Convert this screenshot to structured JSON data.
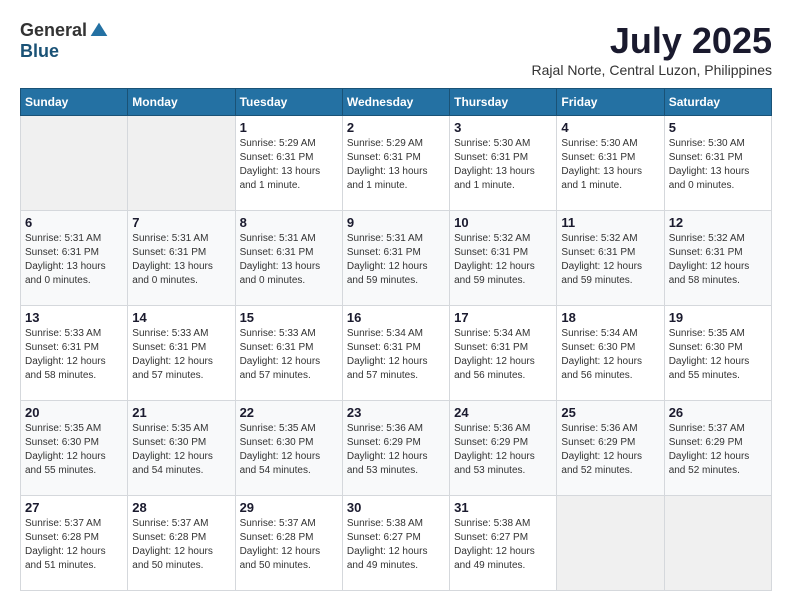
{
  "header": {
    "logo_general": "General",
    "logo_blue": "Blue",
    "month_title": "July 2025",
    "location": "Rajal Norte, Central Luzon, Philippines"
  },
  "days_of_week": [
    "Sunday",
    "Monday",
    "Tuesday",
    "Wednesday",
    "Thursday",
    "Friday",
    "Saturday"
  ],
  "weeks": [
    {
      "days": [
        {
          "number": "",
          "info": ""
        },
        {
          "number": "",
          "info": ""
        },
        {
          "number": "1",
          "info": "Sunrise: 5:29 AM\nSunset: 6:31 PM\nDaylight: 13 hours and 1 minute."
        },
        {
          "number": "2",
          "info": "Sunrise: 5:29 AM\nSunset: 6:31 PM\nDaylight: 13 hours and 1 minute."
        },
        {
          "number": "3",
          "info": "Sunrise: 5:30 AM\nSunset: 6:31 PM\nDaylight: 13 hours and 1 minute."
        },
        {
          "number": "4",
          "info": "Sunrise: 5:30 AM\nSunset: 6:31 PM\nDaylight: 13 hours and 1 minute."
        },
        {
          "number": "5",
          "info": "Sunrise: 5:30 AM\nSunset: 6:31 PM\nDaylight: 13 hours and 0 minutes."
        }
      ]
    },
    {
      "days": [
        {
          "number": "6",
          "info": "Sunrise: 5:31 AM\nSunset: 6:31 PM\nDaylight: 13 hours and 0 minutes."
        },
        {
          "number": "7",
          "info": "Sunrise: 5:31 AM\nSunset: 6:31 PM\nDaylight: 13 hours and 0 minutes."
        },
        {
          "number": "8",
          "info": "Sunrise: 5:31 AM\nSunset: 6:31 PM\nDaylight: 13 hours and 0 minutes."
        },
        {
          "number": "9",
          "info": "Sunrise: 5:31 AM\nSunset: 6:31 PM\nDaylight: 12 hours and 59 minutes."
        },
        {
          "number": "10",
          "info": "Sunrise: 5:32 AM\nSunset: 6:31 PM\nDaylight: 12 hours and 59 minutes."
        },
        {
          "number": "11",
          "info": "Sunrise: 5:32 AM\nSunset: 6:31 PM\nDaylight: 12 hours and 59 minutes."
        },
        {
          "number": "12",
          "info": "Sunrise: 5:32 AM\nSunset: 6:31 PM\nDaylight: 12 hours and 58 minutes."
        }
      ]
    },
    {
      "days": [
        {
          "number": "13",
          "info": "Sunrise: 5:33 AM\nSunset: 6:31 PM\nDaylight: 12 hours and 58 minutes."
        },
        {
          "number": "14",
          "info": "Sunrise: 5:33 AM\nSunset: 6:31 PM\nDaylight: 12 hours and 57 minutes."
        },
        {
          "number": "15",
          "info": "Sunrise: 5:33 AM\nSunset: 6:31 PM\nDaylight: 12 hours and 57 minutes."
        },
        {
          "number": "16",
          "info": "Sunrise: 5:34 AM\nSunset: 6:31 PM\nDaylight: 12 hours and 57 minutes."
        },
        {
          "number": "17",
          "info": "Sunrise: 5:34 AM\nSunset: 6:31 PM\nDaylight: 12 hours and 56 minutes."
        },
        {
          "number": "18",
          "info": "Sunrise: 5:34 AM\nSunset: 6:30 PM\nDaylight: 12 hours and 56 minutes."
        },
        {
          "number": "19",
          "info": "Sunrise: 5:35 AM\nSunset: 6:30 PM\nDaylight: 12 hours and 55 minutes."
        }
      ]
    },
    {
      "days": [
        {
          "number": "20",
          "info": "Sunrise: 5:35 AM\nSunset: 6:30 PM\nDaylight: 12 hours and 55 minutes."
        },
        {
          "number": "21",
          "info": "Sunrise: 5:35 AM\nSunset: 6:30 PM\nDaylight: 12 hours and 54 minutes."
        },
        {
          "number": "22",
          "info": "Sunrise: 5:35 AM\nSunset: 6:30 PM\nDaylight: 12 hours and 54 minutes."
        },
        {
          "number": "23",
          "info": "Sunrise: 5:36 AM\nSunset: 6:29 PM\nDaylight: 12 hours and 53 minutes."
        },
        {
          "number": "24",
          "info": "Sunrise: 5:36 AM\nSunset: 6:29 PM\nDaylight: 12 hours and 53 minutes."
        },
        {
          "number": "25",
          "info": "Sunrise: 5:36 AM\nSunset: 6:29 PM\nDaylight: 12 hours and 52 minutes."
        },
        {
          "number": "26",
          "info": "Sunrise: 5:37 AM\nSunset: 6:29 PM\nDaylight: 12 hours and 52 minutes."
        }
      ]
    },
    {
      "days": [
        {
          "number": "27",
          "info": "Sunrise: 5:37 AM\nSunset: 6:28 PM\nDaylight: 12 hours and 51 minutes."
        },
        {
          "number": "28",
          "info": "Sunrise: 5:37 AM\nSunset: 6:28 PM\nDaylight: 12 hours and 50 minutes."
        },
        {
          "number": "29",
          "info": "Sunrise: 5:37 AM\nSunset: 6:28 PM\nDaylight: 12 hours and 50 minutes."
        },
        {
          "number": "30",
          "info": "Sunrise: 5:38 AM\nSunset: 6:27 PM\nDaylight: 12 hours and 49 minutes."
        },
        {
          "number": "31",
          "info": "Sunrise: 5:38 AM\nSunset: 6:27 PM\nDaylight: 12 hours and 49 minutes."
        },
        {
          "number": "",
          "info": ""
        },
        {
          "number": "",
          "info": ""
        }
      ]
    }
  ]
}
